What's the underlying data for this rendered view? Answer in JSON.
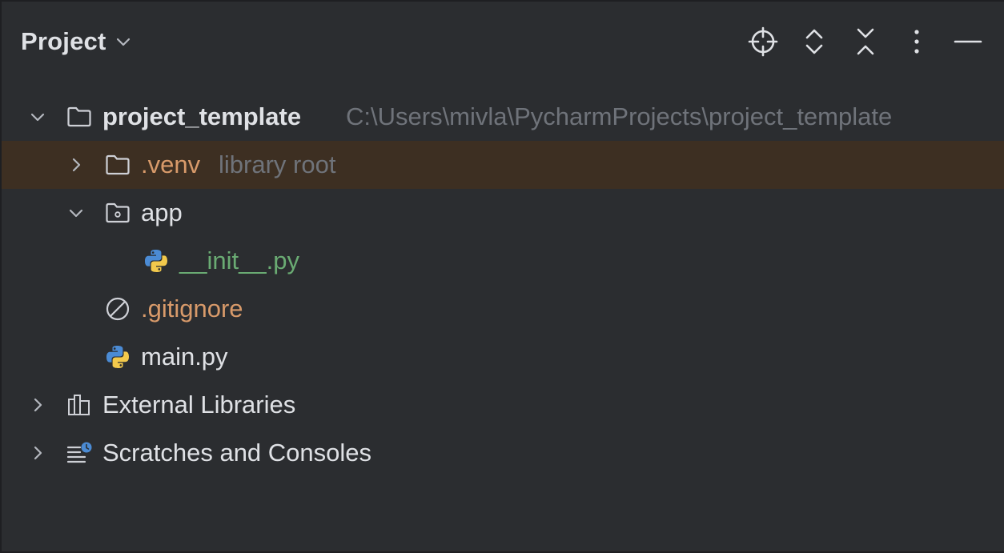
{
  "panel": {
    "title": "Project"
  },
  "toolbar": {
    "icons": [
      "locate-icon",
      "expand-all-icon",
      "collapse-all-icon",
      "more-options-icon",
      "hide-panel-icon"
    ]
  },
  "tree": {
    "root": {
      "name": "project_template",
      "path": "C:\\Users\\mivla\\PycharmProjects\\project_template"
    },
    "venv": {
      "name": ".venv",
      "hint": "library root"
    },
    "app": {
      "name": "app"
    },
    "init_file": {
      "name": "__init__.py"
    },
    "gitignore": {
      "name": ".gitignore"
    },
    "main_file": {
      "name": "main.py"
    },
    "external_libraries": {
      "name": "External Libraries"
    },
    "scratches": {
      "name": "Scratches and Consoles"
    }
  },
  "colors": {
    "background": "#2b2d30",
    "selection": "#2e436e",
    "excluded_row": "#3d2f22",
    "ignored_text": "#d89a6a",
    "new_file_text": "#6aab73"
  }
}
